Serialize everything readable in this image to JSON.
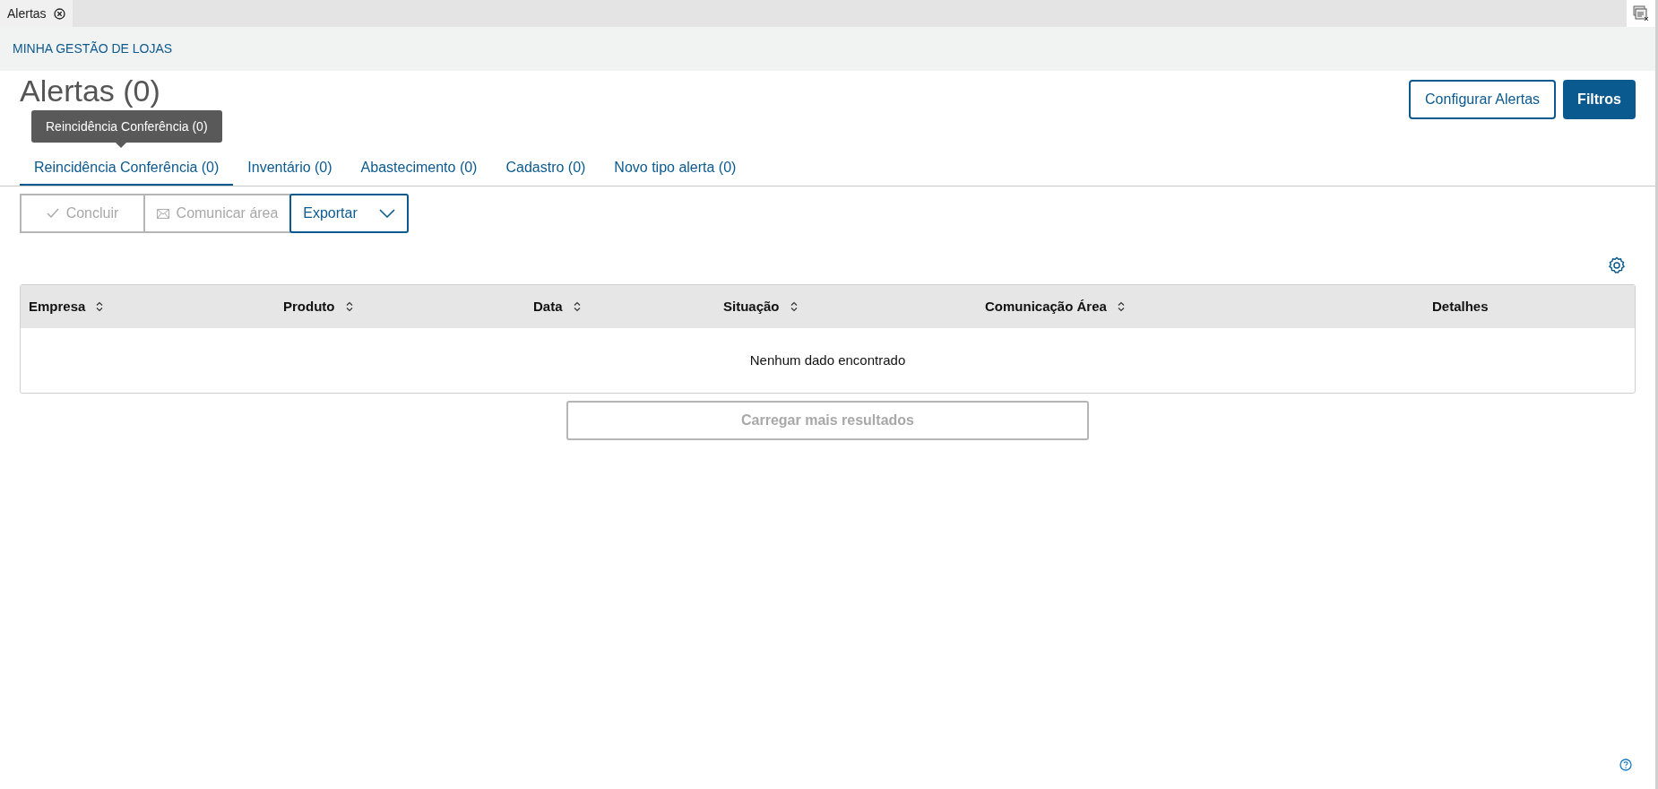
{
  "window_tabs": [
    {
      "label": "Alertas",
      "selected": true
    }
  ],
  "breadcrumb": "MINHA GESTÃO DE LOJAS",
  "title": "Alertas (0)",
  "header_buttons": [
    {
      "label": "Configurar Alertas",
      "kind": "outline"
    },
    {
      "label": "Filtros",
      "kind": "primary"
    }
  ],
  "tooltip": "Reincidência Conferência (0)",
  "tabs": [
    {
      "label": "Reincidência Conferência (0)",
      "selected": true
    },
    {
      "label": "Inventário (0)",
      "selected": false
    },
    {
      "label": "Abastecimento (0)",
      "selected": false
    },
    {
      "label": "Cadastro (0)",
      "selected": false
    },
    {
      "label": "Novo tipo alerta (0)",
      "selected": false
    }
  ],
  "actions": [
    {
      "label": "Concluir",
      "kind": "check",
      "disabled": true
    },
    {
      "label": "Comunicar área",
      "kind": "mail",
      "disabled": true
    },
    {
      "label": "Exportar",
      "kind": "dropdown",
      "disabled": false
    }
  ],
  "table": {
    "columns": [
      {
        "label": "Empresa",
        "sortable": true
      },
      {
        "label": "Produto",
        "sortable": true
      },
      {
        "label": "Data",
        "sortable": true
      },
      {
        "label": "Situação",
        "sortable": true
      },
      {
        "label": "Comunicação Área",
        "sortable": true
      },
      {
        "label": "Detalhes",
        "sortable": false
      }
    ],
    "empty_message": "Nenhum dado encontrado"
  },
  "load_more": {
    "label": "Carregar mais resultados",
    "disabled": true
  }
}
